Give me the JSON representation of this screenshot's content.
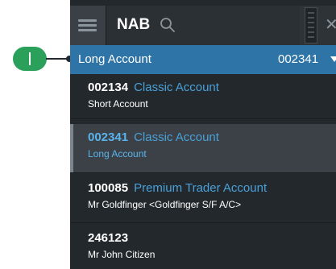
{
  "search": {
    "value": "NAB"
  },
  "selected": {
    "name": "Long Account",
    "number": "002341"
  },
  "accounts": [
    {
      "number": "002134",
      "type": "Classic Account",
      "name": "Short Account",
      "active": false
    },
    {
      "number": "002341",
      "type": "Classic Account",
      "name": "Long Account",
      "active": true
    },
    {
      "number": "100085",
      "type": "Premium Trader Account",
      "name": "Mr Goldfinger <Goldfinger S/F A/C>",
      "active": false
    },
    {
      "number": "246123",
      "type": "",
      "name": "Mr John Citizen",
      "active": false
    }
  ],
  "callout": {
    "marker": "I"
  },
  "colors": {
    "panel": "#23282c",
    "selected_bar": "#2f74a7",
    "account_type": "#4aa0d8",
    "callout": "#2aa05a"
  },
  "icons": {
    "menu": "hamburger-icon",
    "search": "search-icon",
    "grip": "drag-handle-icon",
    "close": "close-icon",
    "caret": "chevron-down-icon"
  }
}
